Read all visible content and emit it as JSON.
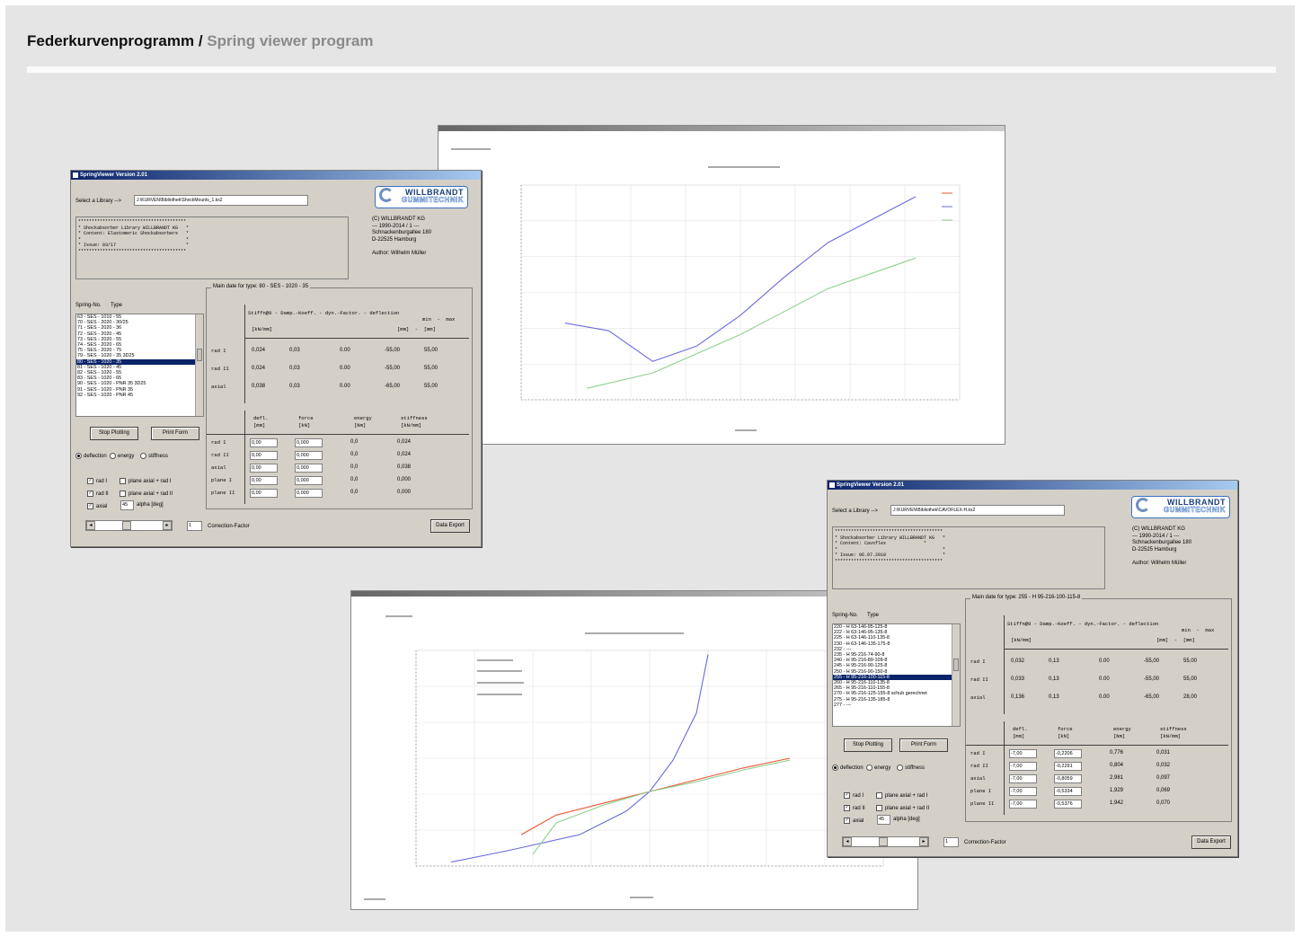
{
  "page": {
    "title_main": "Federkurvenprogramm /",
    "title_sub": "Spring viewer program"
  },
  "colors": {
    "page_bg": "#e5e5e5",
    "window_bg": "#d4d0c8",
    "selection": "#0a246a",
    "series_blue": "#6a6adc",
    "series_green": "#8fd08f",
    "series_red": "#ee5533"
  },
  "win1": {
    "title": "SpringViewer Version 2.01",
    "select_library_label": "Select a Library -->",
    "library_path": "J:\\KURVEN\\Bibliothek\\ShockMounts_1.ks2",
    "memo_text": "****************************************\n* Shockabsorber Library WILLBRANDT KG   *\n* Content: Elastomeric Shockabsorbers   *\n*                                       *\n* Issue: 03/17                          *\n****************************************",
    "logo_line1": "WILLBRANDT",
    "logo_line2": "GUMMITECHNIK",
    "company_text": "(C) WILLBRANDT KG\n--- 1990-2014 / 1 ---\nSchnackenburgallee 180\nD-22525 Hamburg\n\nAuthor: Wilhelm Müller",
    "spring_no_label": "Spring-No.",
    "type_label": "Type",
    "list_items": [
      "63 - SES - 1010 - 55",
      "70 - SES - 2020 - 30/25",
      "71 - SES - 2020 - 36",
      "72 - SES - 2020 - 45",
      "73 - SES - 2020 - 55",
      "74 - SES - 2020 - 65",
      "75 - SES - 2020 - 75",
      "79 - SES - 1020 - 35 3D25",
      "80 - SES - 1020 - 35",
      "81 - SES - 1020 - 45",
      "82 - SES - 1020 - 55",
      "83 - SES - 1020 - 65",
      "90 - SES - 1020 - PNR 35 3D25",
      "91 - SES - 1020 - PNR 35",
      "92 - SES - 1020 - PNR 45"
    ],
    "selected_index": 8,
    "stop_plotting": "Stop Plotting",
    "print_form": "Print Form",
    "opt_deflection": "deflection",
    "opt_energy": "energy",
    "opt_stiffness": "stiffness",
    "chk_rad1": "rad I",
    "chk_rad2": "rad II",
    "chk_axial": "axial",
    "chk_plane1": "plane axial + rad I",
    "chk_plane2": "plane axial + rad II",
    "alpha_value": "45",
    "alpha_label": "alpha [deg]",
    "correction_value": "1",
    "correction_label": "Correction-Factor",
    "data_export": "Data Export",
    "main_caption": "Main date for type:  80 - SES - 1020 - 35",
    "head1": "Stiffn@0 - Damp.-Koeff. - dyn.-Factor. - deflection",
    "head1b": "min  -  max",
    "head1c_unit": "[kN/mm]",
    "head1c_mm": "[mm]  -  [mm]",
    "rows1": [
      {
        "name": "rad I",
        "stiff": "0,024",
        "damp": "0,03",
        "dyn": "0.00",
        "min": "-55,00",
        "max": "55,00"
      },
      {
        "name": "rad II",
        "stiff": "0,024",
        "damp": "0,03",
        "dyn": "0.00",
        "min": "-55,00",
        "max": "55,00"
      },
      {
        "name": "axial",
        "stiff": "0,038",
        "damp": "0,03",
        "dyn": "0.00",
        "min": "-65,00",
        "max": "55,00"
      }
    ],
    "head2": [
      "defl.",
      "force",
      "energy",
      "stiffness"
    ],
    "head2_units": [
      "[mm]",
      "[kN]",
      "[Nm]",
      "[kN/mm]"
    ],
    "rows2": [
      {
        "name": "rad I",
        "defl": "0,00",
        "force": "0,000",
        "energy": "0,0",
        "stiff": "0,024"
      },
      {
        "name": "rad II",
        "defl": "0,00",
        "force": "0,000",
        "energy": "0,0",
        "stiff": "0,024"
      },
      {
        "name": "axial",
        "defl": "0,00",
        "force": "0,000",
        "energy": "0,0",
        "stiff": "0,038"
      },
      {
        "name": "plane I",
        "defl": "0,00",
        "force": "0,000",
        "energy": "0,0",
        "stiff": "0,000"
      },
      {
        "name": "plane II",
        "defl": "0,00",
        "force": "0,000",
        "energy": "0,0",
        "stiff": "0,000"
      }
    ]
  },
  "win2": {
    "title": "SpringViewer Version 2.01",
    "select_library_label": "Select a Library -->",
    "library_path": "J:\\KURVEN\\Bibliothek\\CAVOFLEX-H.ks2",
    "memo_text": "****************************************\n* Shockabsorber Library WILLBRANDT KG   *\n* Content: Cavoflex              *\n*                                       *\n* Issue: 06.07.2018                     *\n****************************************",
    "logo_line1": "WILLBRANDT",
    "logo_line2": "GUMMITECHNIK",
    "company_text": "(C) WILLBRANDT KG\n--- 1990-2014 / 1 ---\nSchnackenburgallee 180\nD-22525 Hamburg\n\nAuthor: Wilhelm Müller",
    "spring_no_label": "Spring-No.",
    "type_label": "Type",
    "list_items": [
      "220 - H 63-146-95-125-8",
      "222 - H 63-146-95-135-8",
      "225 - H 63-146-110-135-8",
      "230 - H 63-146-135-175-8",
      "232 - ---",
      "235 - H 95-216-74-90-8",
      "240 - H 95-216-89-109-8",
      "245 - H 95-216-90-125-8",
      "250 - H 95-216-90-150-8",
      "255 - H 95-216-100-115-8",
      "260 - H 95-216-110-135-8",
      "265 - H 95-216-110-155-8",
      "270 - H 95-216-125-155-8 schub gerechnet",
      "275 - H 95-216-135-185-8",
      "277 - ---"
    ],
    "selected_index": 9,
    "stop_plotting": "Stop Plotting",
    "print_form": "Print Form",
    "opt_deflection": "deflection",
    "opt_energy": "energy",
    "opt_stiffness": "stiffness",
    "chk_rad1": "rad I",
    "chk_rad2": "rad II",
    "chk_axial": "axial",
    "chk_plane1": "plane axial + rad I",
    "chk_plane2": "plane axial + rad II",
    "alpha_value": "45",
    "alpha_label": "alpha [deg]",
    "correction_value": "1",
    "correction_label": "Correction-Factor",
    "data_export": "Data Export",
    "main_caption": "Main date for type:  255 - H 95-216-100-115-8",
    "head1": "Stiffn@0 - Damp.-Koeff. - dyn.-Factor. - deflection",
    "head1b": "min  -  max",
    "head1c_unit": "[kN/mm]",
    "head1c_mm": "[mm]  -  [mm]",
    "rows1": [
      {
        "name": "rad I",
        "stiff": "0,032",
        "damp": "0,13",
        "dyn": "0.00",
        "min": "-55,00",
        "max": "55,00"
      },
      {
        "name": "rad II",
        "stiff": "0,033",
        "damp": "0,13",
        "dyn": "0.00",
        "min": "-55,00",
        "max": "55,00"
      },
      {
        "name": "axial",
        "stiff": "0,136",
        "damp": "0,13",
        "dyn": "0.00",
        "min": "-65,00",
        "max": "28,00"
      }
    ],
    "head2": [
      "defl.",
      "force",
      "energy",
      "stiffness"
    ],
    "head2_units": [
      "[mm]",
      "[kN]",
      "[Nm]",
      "[kN/mm]"
    ],
    "rows2": [
      {
        "name": "rad I",
        "defl": "-7,00",
        "force": "-0,2206",
        "energy": "0,776",
        "stiff": "0,031"
      },
      {
        "name": "rad II",
        "defl": "-7,00",
        "force": "-0,2291",
        "energy": "0,804",
        "stiff": "0,032"
      },
      {
        "name": "axial",
        "defl": "-7,00",
        "force": "-0,8059",
        "energy": "2,981",
        "stiff": "0,097"
      },
      {
        "name": "plane I",
        "defl": "-7,00",
        "force": "-0,5334",
        "energy": "1,929",
        "stiff": "0,069"
      },
      {
        "name": "plane II",
        "defl": "-7,00",
        "force": "-0,5376",
        "energy": "1,942",
        "stiff": "0,070"
      }
    ]
  },
  "chart_data": [
    {
      "type": "line",
      "xlim": [
        -100,
        100
      ],
      "series": [
        {
          "color": "#6a6adc",
          "x": [
            -80,
            -60,
            -40,
            -20,
            0,
            20,
            40,
            60,
            80
          ],
          "y": [
            0.4,
            0.3,
            -0.1,
            0.1,
            0.5,
            1.0,
            1.45,
            1.75,
            2.05
          ]
        },
        {
          "color": "#8fd08f",
          "x": [
            -70,
            -40,
            -20,
            0,
            20,
            40,
            60,
            80
          ],
          "y": [
            -0.45,
            -0.25,
            0.0,
            0.25,
            0.55,
            0.85,
            1.05,
            1.25
          ]
        }
      ]
    },
    {
      "type": "line",
      "xlim": [
        -100,
        100
      ],
      "series": [
        {
          "color": "#6a6adc",
          "x": [
            -85,
            -60,
            -30,
            -10,
            0,
            10,
            20,
            25
          ],
          "y": [
            -2.3,
            -2.0,
            -1.6,
            -1.0,
            -0.5,
            0.3,
            1.5,
            3.0
          ]
        },
        {
          "color": "#ee5533",
          "x": [
            -55,
            -40,
            -20,
            0,
            20,
            40,
            60
          ],
          "y": [
            -1.6,
            -1.1,
            -0.8,
            -0.5,
            -0.2,
            0.1,
            0.35
          ]
        },
        {
          "color": "#8fd08f",
          "x": [
            -50,
            -40,
            -20,
            0,
            20,
            40,
            60
          ],
          "y": [
            -2.1,
            -1.3,
            -0.85,
            -0.5,
            -0.25,
            0.05,
            0.3
          ]
        }
      ]
    }
  ]
}
